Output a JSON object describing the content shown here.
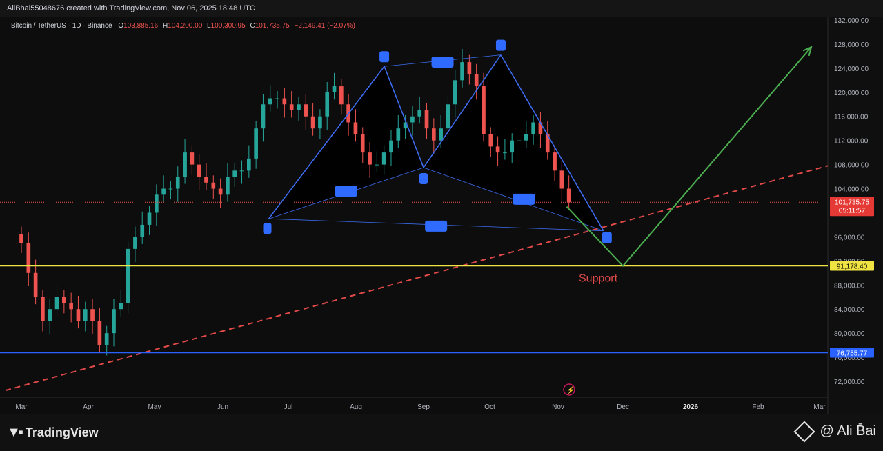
{
  "header": {
    "credit": "AliBhai55048676 created with TradingView.com, Nov 06, 2025 18:48 UTC"
  },
  "legend": {
    "symbol": "Bitcoin / TetherUS · 1D · Binance",
    "o_label": "O",
    "o_value": "103,885.16",
    "h_label": "H",
    "h_value": "104,200.00",
    "l_label": "L",
    "l_value": "100,300.95",
    "c_label": "C",
    "c_value": "101,735.75",
    "change": "−2,149.41 (−2.07%)"
  },
  "price_axis": {
    "ticks": [
      "132,000.00",
      "128,000.00",
      "124,000.00",
      "120,000.00",
      "116,000.00",
      "112,000.00",
      "108,000.00",
      "104,000.00",
      "96,000.00",
      "92,000.00",
      "88,000.00",
      "84,000.00",
      "80,000.00",
      "76,000.00",
      "72,000.00"
    ],
    "current_price": "101,735.75",
    "countdown": "05:11:57",
    "support_price": "91,178.40",
    "low_price": "76,755.77"
  },
  "time_axis": {
    "labels": [
      "Mar",
      "Apr",
      "May",
      "Jun",
      "Jul",
      "Aug",
      "Sep",
      "Oct",
      "Nov",
      "Dec",
      "2026",
      "Feb",
      "Mar"
    ]
  },
  "annotations": {
    "support": "Support"
  },
  "footer": {
    "logo_text": "TradingView",
    "brand_text": "@ Ali B̄ai"
  },
  "colors": {
    "up": "#26a69a",
    "down": "#ef5350",
    "support": "#f0e443",
    "low_line": "#2962ff",
    "trend": "#e24a4a",
    "pattern": "#3d6cf0",
    "projection": "#4caf50",
    "label_box": "#2f6bff"
  },
  "chart_data": {
    "type": "candlestick",
    "x_labels": [
      "Mar",
      "Apr",
      "May",
      "Jun",
      "Jul",
      "Aug",
      "Sep",
      "Oct",
      "Nov",
      "Dec",
      "2026",
      "Feb",
      "Mar"
    ],
    "ylim": [
      70000,
      133000
    ],
    "series": [
      {
        "name": "Bitcoin / TetherUS",
        "close": [
          95000,
          90000,
          86000,
          82000,
          84000,
          86000,
          85000,
          84000,
          82000,
          84000,
          82000,
          78000,
          80000,
          84000,
          85000,
          94000,
          96000,
          98000,
          100000,
          103000,
          104000,
          104000,
          106000,
          110000,
          108000,
          106000,
          105000,
          104000,
          103000,
          106000,
          107000,
          107000,
          109000,
          114000,
          118000,
          119000,
          119000,
          118000,
          117000,
          118000,
          116000,
          114000,
          116000,
          120000,
          121000,
          118000,
          115000,
          113000,
          110000,
          108000,
          108000,
          110000,
          112000,
          114000,
          115000,
          116000,
          117000,
          114000,
          112000,
          114000,
          118000,
          122000,
          125000,
          123000,
          121000,
          113000,
          111000,
          110000,
          110000,
          112000,
          112000,
          113000,
          115000,
          113000,
          110000,
          107000,
          104000,
          101735
        ]
      }
    ],
    "levels": [
      {
        "name": "Support",
        "price": 91178.4
      },
      {
        "price": 76755.77
      }
    ],
    "pattern_points": [
      {
        "date": "Jun 22",
        "price": 99000
      },
      {
        "date": "Aug 14",
        "price": 124300
      },
      {
        "date": "Sep 01",
        "price": 107500
      },
      {
        "date": "Oct 06",
        "price": 126200
      },
      {
        "date": "Nov 22",
        "price": 97000
      }
    ],
    "projection": [
      {
        "date": "Nov 05",
        "price": 101000
      },
      {
        "date": "Dec 01",
        "price": 91178.4
      },
      {
        "date": "Mar 01",
        "price": 127500
      }
    ]
  }
}
